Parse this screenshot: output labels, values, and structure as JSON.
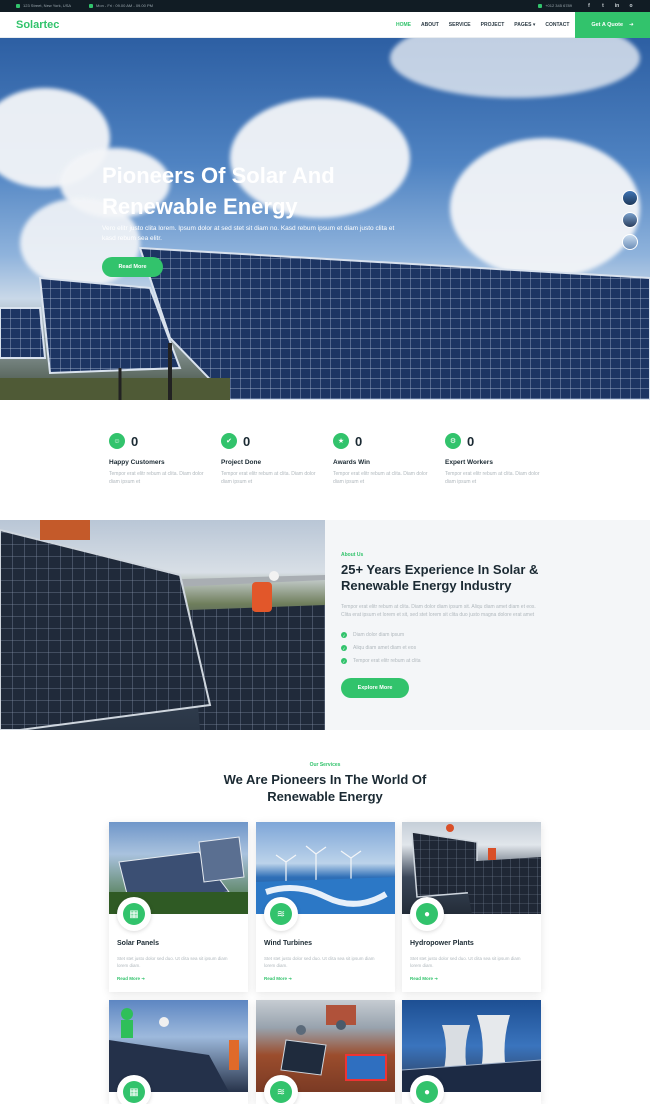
{
  "topbar": {
    "address": "123 Street, New York, USA",
    "hours": "Mon - Fri : 09.00 AM - 09.00 PM",
    "phone": "+012 345 6789",
    "social": [
      "f",
      "t",
      "in",
      "o"
    ]
  },
  "nav": {
    "logo": "Solartec",
    "items": [
      "HOME",
      "ABOUT",
      "SERVICE",
      "PROJECT",
      "PAGES",
      "CONTACT"
    ],
    "quote_button": "Get A Quote"
  },
  "hero": {
    "title": "Pioneers Of Solar And Renewable Energy",
    "subtitle": "Vero elitr justo clita lorem. Ipsum dolor at sed stet sit diam no. Kasd rebum ipsum et diam justo clita et kasd rebum sea elitr.",
    "button": "Read More"
  },
  "stats": [
    {
      "number": "0",
      "label": "Happy Customers",
      "text": "Tempor erat elitr rebum at clita. Diam dolor diam ipsum et"
    },
    {
      "number": "0",
      "label": "Project Done",
      "text": "Tempor erat elitr rebum at clita. Diam dolor diam ipsum et"
    },
    {
      "number": "0",
      "label": "Awards Win",
      "text": "Tempor erat elitr rebum at clita. Diam dolor diam ipsum et"
    },
    {
      "number": "0",
      "label": "Expert Workers",
      "text": "Tempor erat elitr rebum at clita. Diam dolor diam ipsum et"
    }
  ],
  "about": {
    "tag": "About Us",
    "title": "25+ Years Experience In Solar & Renewable Energy Industry",
    "text": "Tempor erat elitr rebum at clita. Diam dolor diam ipsum sit. Aliqu diam amet diam et eos. Clita erat ipsum et lorem et sit, sed stet lorem sit clita duo justo magna dolore erat amet",
    "checks": [
      "Diam dolor diam ipsum",
      "Aliqu diam amet diam et eos",
      "Tempor erat elitr rebum at clita"
    ],
    "button": "Explore More"
  },
  "services": {
    "tag": "Our Services",
    "title": "We Are Pioneers In The World Of Renewable Energy",
    "cards": [
      {
        "title": "Solar Panels",
        "text": "Stet stet justo dolor sed duo. Ut clita sea sit ipsum diam lorem diam.",
        "link": "Read More"
      },
      {
        "title": "Wind Turbines",
        "text": "Stet stet justo dolor sed duo. Ut clita sea sit ipsum diam lorem diam.",
        "link": "Read More"
      },
      {
        "title": "Hydropower Plants",
        "text": "Stet stet justo dolor sed duo. Ut clita sea sit ipsum diam lorem diam.",
        "link": "Read More"
      }
    ]
  },
  "colors": {
    "accent": "#32c36c",
    "dark": "#1b2a33",
    "topbar": "#111c24"
  }
}
